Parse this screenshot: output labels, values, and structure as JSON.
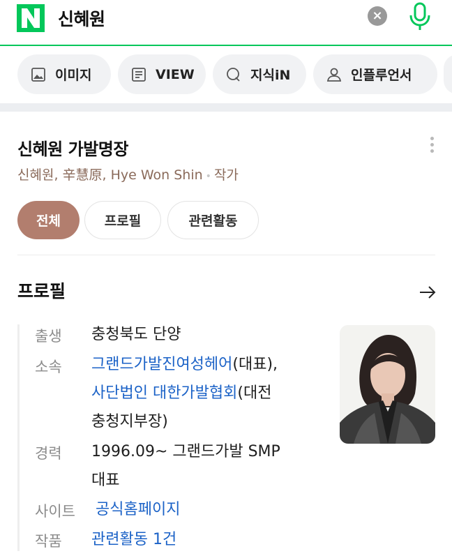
{
  "search": {
    "query": "신혜원",
    "clear_symbol": "×"
  },
  "tabs": [
    {
      "label": "이미지",
      "icon": "image-icon"
    },
    {
      "label": "VIEW",
      "icon": "document-icon"
    },
    {
      "label": "지식iN",
      "icon": "kin-q-icon"
    },
    {
      "label": "인플루언서",
      "icon": "person-icon"
    }
  ],
  "profile_card": {
    "title": "신혜원 가발명장",
    "subtitle_names": "신혜원, 辛慧原, Hye Won Shin",
    "subtitle_separator": "•",
    "subtitle_role": "작가",
    "chips": [
      "전체",
      "프로필",
      "관련활동"
    ],
    "section_title": "프로필"
  },
  "info": {
    "birth_label": "출생",
    "birth_value": "충청북도 단양",
    "affiliation_label": "소속",
    "affiliation_link1": "그랜드가발진여성헤어",
    "affiliation_text1": "(대표),",
    "affiliation_link2": "사단법인 대한가발협회",
    "affiliation_text2": "(대전",
    "affiliation_text3": "충청지부장)",
    "career_label": "경력",
    "career_line1": "1996.09~ 그랜드가발 SMP",
    "career_line2": "대표",
    "site_label": "사이트",
    "site_link": "공식홈페이지",
    "works_label": "작품",
    "works_link": "관련활동 1건"
  },
  "colors": {
    "brand_green": "#03c75a",
    "chip_active": "#b27e6e",
    "link_blue": "#1b62c7"
  }
}
